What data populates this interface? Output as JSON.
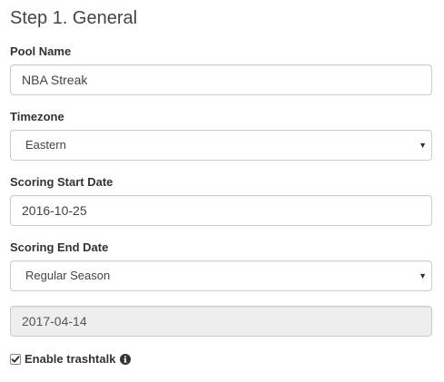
{
  "form": {
    "title": "Step 1. General",
    "pool_name": {
      "label": "Pool Name",
      "value": "NBA Streak"
    },
    "timezone": {
      "label": "Timezone",
      "selected": "Eastern"
    },
    "scoring_start_date": {
      "label": "Scoring Start Date",
      "value": "2016-10-25"
    },
    "scoring_end_date": {
      "label": "Scoring End Date",
      "selected": "Regular Season",
      "date_value": "2017-04-14"
    },
    "trashtalk": {
      "label": "Enable trashtalk",
      "checked": true
    }
  },
  "icons": {
    "select_caret": "caret-down-icon",
    "checkbox_check": "checkmark-icon",
    "info": "info-circle-icon"
  }
}
